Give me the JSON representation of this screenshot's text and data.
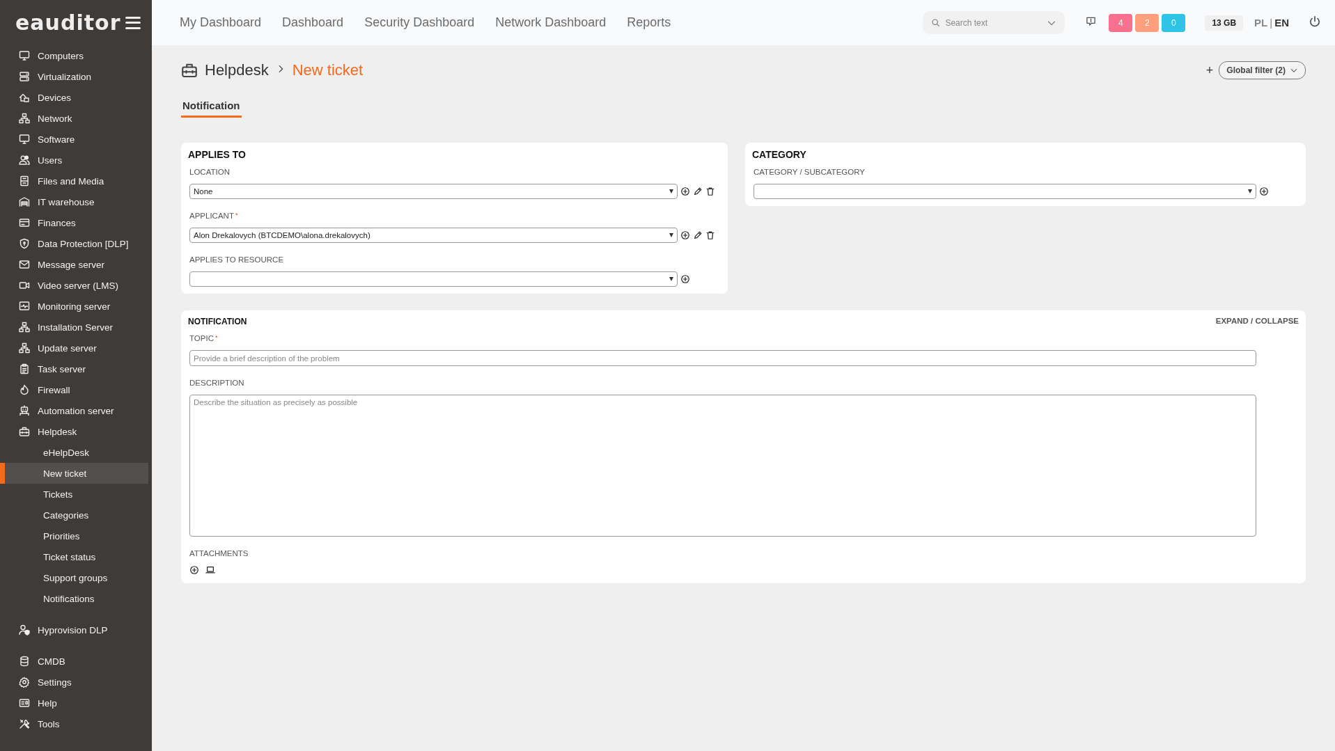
{
  "logo": "eauditor",
  "sidebar": {
    "groups": [
      [
        {
          "label": "Computers",
          "selected": false
        },
        {
          "label": "Virtualization",
          "selected": false
        },
        {
          "label": "Devices",
          "selected": false
        },
        {
          "label": "Network",
          "selected": false
        },
        {
          "label": "Software",
          "selected": false
        },
        {
          "label": "Users",
          "selected": false
        },
        {
          "label": "Files and Media",
          "selected": false
        },
        {
          "label": "IT warehouse",
          "selected": false
        },
        {
          "label": "Finances",
          "selected": false
        },
        {
          "label": "Data Protection [DLP]",
          "selected": false
        },
        {
          "label": "Message server",
          "selected": false
        },
        {
          "label": "Video server (LMS)",
          "selected": false
        },
        {
          "label": "Monitoring server",
          "selected": false
        },
        {
          "label": "Installation Server",
          "selected": false
        },
        {
          "label": "Update server",
          "selected": false
        },
        {
          "label": "Task server",
          "selected": false
        },
        {
          "label": "Firewall",
          "selected": false
        },
        {
          "label": "Automation server",
          "selected": false
        },
        {
          "label": "Helpdesk",
          "selected": false,
          "children": [
            {
              "label": "eHelpDesk",
              "selected": false
            },
            {
              "label": "New ticket",
              "selected": true
            },
            {
              "label": "Tickets",
              "selected": false
            },
            {
              "label": "Categories",
              "selected": false
            },
            {
              "label": "Priorities",
              "selected": false
            },
            {
              "label": "Ticket status",
              "selected": false
            },
            {
              "label": "Support groups",
              "selected": false
            },
            {
              "label": "Notifications",
              "selected": false
            }
          ]
        }
      ],
      [
        {
          "label": "Hyprovision DLP",
          "selected": false
        }
      ],
      [
        {
          "label": "CMDB",
          "selected": false
        },
        {
          "label": "Settings",
          "selected": false
        },
        {
          "label": "Help",
          "selected": false
        },
        {
          "label": "Tools",
          "selected": false
        }
      ]
    ]
  },
  "topbar": {
    "nav": [
      "My Dashboard",
      "Dashboard",
      "Security Dashboard",
      "Network Dashboard",
      "Reports"
    ],
    "search": {
      "placeholder": "Search text"
    },
    "badges": [
      {
        "count": "4",
        "color": "#f7718f"
      },
      {
        "count": "2",
        "color": "#fd9f7d"
      },
      {
        "count": "0",
        "color": "#2fc3e6"
      }
    ],
    "storage": "13 GB",
    "languages": [
      {
        "label": "PL",
        "selected": false
      },
      {
        "label": "EN",
        "selected": true
      }
    ],
    "language_separator": "|"
  },
  "breadcrumb": {
    "items": [
      "Helpdesk",
      "New ticket"
    ]
  },
  "filter": {
    "add": "+",
    "label": "Global filter (2)"
  },
  "tabs": [
    {
      "label": "Notification",
      "selected": true
    }
  ],
  "applies_to": {
    "title": "APPLIES TO",
    "fields": [
      {
        "label": "LOCATION",
        "value": "None",
        "required": false,
        "editable": true
      },
      {
        "label": "APPLICANT",
        "value": "Alon Drekalovych (BTCDEMO\\alona.drekalovych)",
        "required": true,
        "editable": true
      },
      {
        "label": "APPLIES TO RESOURCE",
        "required": false,
        "editable": false
      }
    ]
  },
  "category": {
    "title": "CATEGORY",
    "fields": [
      {
        "label": "CATEGORY / SUBCATEGORY",
        "required": false,
        "editable": false
      }
    ]
  },
  "required_mark": "*",
  "notification": {
    "title": "NOTIFICATION",
    "toggle": "EXPAND / COLLAPSE",
    "topic": {
      "label": "TOPIC",
      "required": true,
      "placeholder": "Provide a brief description of the problem"
    },
    "description": {
      "label": "DESCRIPTION",
      "placeholder": "Describe the situation as precisely as possible"
    },
    "attachments": {
      "label": "ATTACHMENTS"
    }
  }
}
